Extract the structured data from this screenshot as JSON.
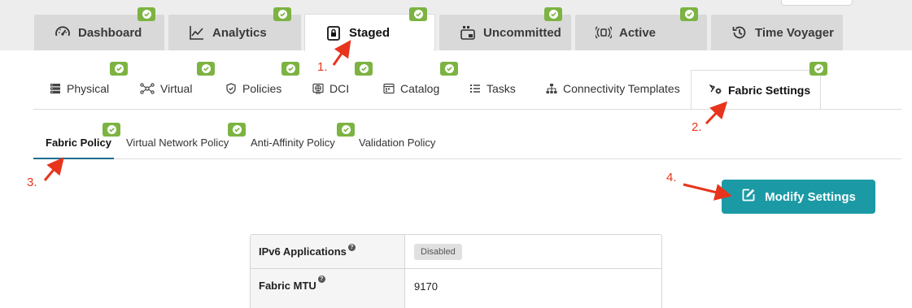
{
  "main_tabs": [
    {
      "label": "Dashboard",
      "icon": "speedometer-icon",
      "active": false
    },
    {
      "label": "Analytics",
      "icon": "line-chart-icon",
      "active": false
    },
    {
      "label": "Staged",
      "icon": "lock-icon",
      "active": true
    },
    {
      "label": "Uncommitted",
      "icon": "uncommitted-icon",
      "active": false
    },
    {
      "label": "Active",
      "icon": "broadcast-icon",
      "active": false
    },
    {
      "label": "Time Voyager",
      "icon": "history-icon",
      "active": false
    }
  ],
  "sub_tabs": [
    {
      "label": "Physical",
      "icon": "server-icon"
    },
    {
      "label": "Virtual",
      "icon": "network-icon"
    },
    {
      "label": "Policies",
      "icon": "shield-icon"
    },
    {
      "label": "DCI",
      "icon": "globe-icon"
    },
    {
      "label": "Catalog",
      "icon": "catalog-icon"
    },
    {
      "label": "Tasks",
      "icon": "list-icon"
    },
    {
      "label": "Connectivity Templates",
      "icon": "hierarchy-icon"
    },
    {
      "label": "Fabric Settings",
      "icon": "fabric-settings-icon",
      "active": true
    }
  ],
  "policy_tabs": [
    {
      "label": "Fabric Policy",
      "active": true
    },
    {
      "label": "Virtual Network Policy"
    },
    {
      "label": "Anti-Affinity Policy"
    },
    {
      "label": "Validation Policy"
    }
  ],
  "modify_button": {
    "label": "Modify Settings",
    "icon": "edit-icon"
  },
  "settings": [
    {
      "key": "IPv6 Applications",
      "value": "Disabled"
    },
    {
      "key": "Fabric MTU",
      "value": "9170"
    }
  ],
  "help_glyph": "?",
  "annotations": [
    "1.",
    "2.",
    "3.",
    "4."
  ],
  "colors": {
    "badge_green": "#7cb342",
    "primary_teal": "#1b9aa6",
    "annotation_red": "#e8341c",
    "active_underline": "#1c6e8c"
  }
}
